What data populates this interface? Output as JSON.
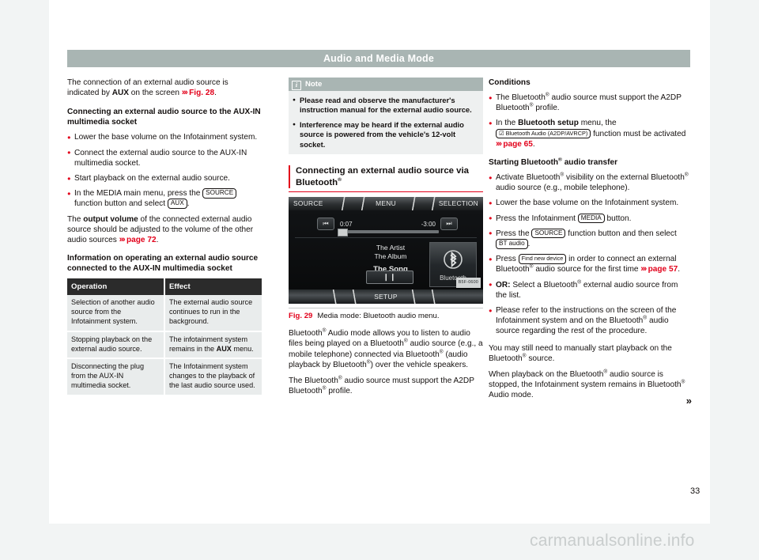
{
  "header": {
    "title": "Audio and Media Mode"
  },
  "page": {
    "number": "33",
    "watermark": "carmanualsonline.info",
    "end_mark": "»"
  },
  "col1": {
    "intro_1": "The connection of an external audio source is indicated by ",
    "intro_aux": "AUX",
    "intro_2": " on the screen ",
    "intro_arrows": "›››",
    "intro_ref": "Fig. 28",
    "intro_end": ".",
    "heading_1": "Connecting an external audio source to the AUX-IN multimedia socket",
    "bullets": [
      "Lower the base volume on the Infotainment system.",
      "Connect the external audio source to the AUX-IN multimedia socket.",
      "Start playback on the external audio source."
    ],
    "bullet_media_a": "In the MEDIA main menu, press the ",
    "bullet_media_key1": "SOURCE",
    "bullet_media_b": " function button and select ",
    "bullet_media_key2": "AUX",
    "bullet_media_c": ".",
    "para_volume_a": "The ",
    "para_volume_b": "output volume",
    "para_volume_c": " of the connected external audio source should be adjusted to the volume of the other audio sources ",
    "para_volume_arrows": "›››",
    "para_volume_ref": "page 72",
    "para_volume_end": ".",
    "heading_2": "Information on operating an external audio source connected to the AUX-IN multimedia socket",
    "table": {
      "headers": [
        "Operation",
        "Effect"
      ],
      "rows": [
        {
          "operation": "Selection of another audio source from the Infotainment system.",
          "effect": "The external audio source continues to run in the background."
        },
        {
          "operation": "Stopping playback on the external audio source.",
          "effect_a": "The infotainment system remains in the ",
          "effect_bold": "AUX",
          "effect_b": " menu."
        },
        {
          "operation": "Disconnecting the plug from the AUX-IN multimedia socket.",
          "effect": "The Infotainment system changes to the playback of the last audio source used."
        }
      ]
    }
  },
  "col2": {
    "note": {
      "icon": "info-icon",
      "title": "Note",
      "bullets": [
        "Please read and observe the manufacturer's instruction manual for the external audio source.",
        "Interference may be heard if the external audio source is powered from the vehicle's 12-volt socket."
      ]
    },
    "section_heading_a": "Connecting an external audio source via Bluetooth",
    "section_heading_sup": "®",
    "figure": {
      "tabs": {
        "source": "SOURCE",
        "menu": "MENU",
        "selection": "SELECTION",
        "setup": "SETUP"
      },
      "time_elapsed": "0:07",
      "time_remaining": "-3:00",
      "prev_icon": "skip-previous-icon",
      "next_icon": "skip-next-icon",
      "artist": "The Artist",
      "album": "The Album",
      "song": "The Song",
      "pause_icon": "pause-icon",
      "bt_label": "Bluetooth",
      "bt_icon": "bluetooth-icon",
      "image_code": "B5F-0600",
      "caption_number": "Fig. 29",
      "caption_text": "Media mode: Bluetooth audio menu."
    },
    "body_p1_a": "Bluetooth",
    "body_p1_b": " Audio mode allows you to listen to audio files being played on a Bluetooth",
    "body_p1_c": " audio source (e.g., a mobile telephone) connected via Bluetooth",
    "body_p1_d": " (audio playback by Bluetooth",
    "body_p1_e": ") over the vehicle speakers.",
    "body_p2_a": "The Bluetooth",
    "body_p2_b": " audio source must support the A2DP Bluetooth",
    "body_p2_c": " profile."
  },
  "col3": {
    "heading_conditions": "Conditions",
    "cond1_a": "The Bluetooth",
    "cond1_b": " audio source must support the A2DP Bluetooth",
    "cond1_c": " profile.",
    "cond2_a": "In the ",
    "cond2_bold": "Bluetooth setup",
    "cond2_b": " menu, the ",
    "cond2_key": "☑ Bluetooth Audio (A2DP/AVRCP)",
    "cond2_c": " function must be activated ",
    "cond2_arrows": "›››",
    "cond2_ref": "page 65",
    "cond2_end": ".",
    "heading_start_a": "Starting Bluetooth",
    "heading_start_b": " audio transfer",
    "step1_a": "Activate Bluetooth",
    "step1_b": " visibility on the external Bluetooth",
    "step1_c": " audio source (e.g., mobile telephone).",
    "step2": "Lower the base volume on the Infotainment system.",
    "step3_a": "Press the Infotainment ",
    "step3_key": "MEDIA",
    "step3_b": " button.",
    "step4_a": "Press the ",
    "step4_key1": "SOURCE",
    "step4_b": " function button and then select ",
    "step4_key2": "BT audio",
    "step4_c": ".",
    "step5_a": "Press ",
    "step5_key": "Find new device",
    "step5_b": " in order to connect an external Bluetooth",
    "step5_c": " audio source for the first time ",
    "step5_arrows": "›››",
    "step5_ref": "page 57",
    "step5_end": ".",
    "step6_bold": "OR:",
    "step6_a": " Select a Bluetooth",
    "step6_b": " external audio source from the list.",
    "step7": "Please refer to the instructions on the screen of the Infotainment system and on the Bluetooth",
    "step7_b": " audio source regarding the rest of the procedure.",
    "para_manual_a": "You may still need to manually start playback on the Bluetooth",
    "para_manual_b": " source.",
    "para_stop_a": "When playback on the Bluetooth",
    "para_stop_b": " audio source is stopped, the Infotainment system remains in Bluetooth",
    "para_stop_c": " Audio mode."
  },
  "colors": {
    "accent_red": "#e2001a",
    "header_band": "#a9b5b3",
    "table_header": "#2b2b2b",
    "table_cell": "#e9ecec",
    "note_body": "#eef0f0"
  }
}
